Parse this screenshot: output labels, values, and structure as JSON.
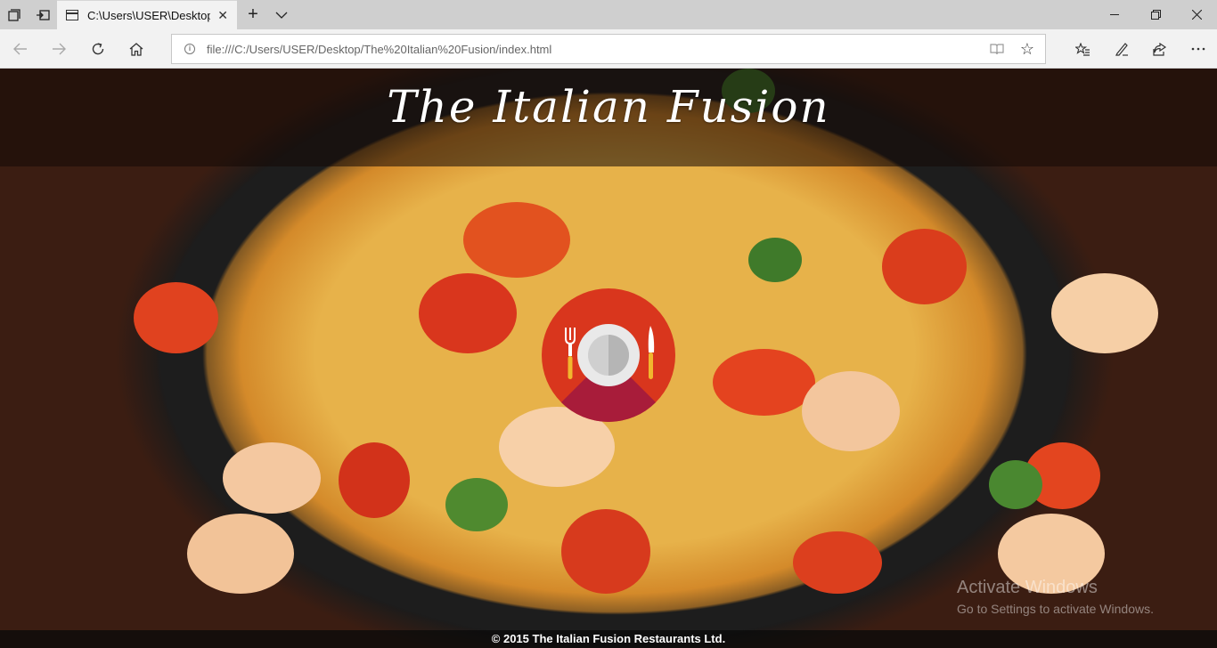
{
  "browser": {
    "tab": {
      "title": "C:\\Users\\USER\\Desktop"
    },
    "address": {
      "url": "file:///C:/Users/USER/Desktop/The%20Italian%20Fusion/index.html"
    }
  },
  "page": {
    "site_title": "The Italian Fusion",
    "footer": "© 2015 The Italian Fusion Restaurants Ltd."
  },
  "watermark": {
    "title": "Activate Windows",
    "subtitle": "Go to Settings to activate Windows."
  },
  "colors": {
    "logo_circle": "#d9361d",
    "logo_shadow": "#a81c3a",
    "tab_strip": "#cfcfcf",
    "nav_bar": "#f2f2f2"
  }
}
